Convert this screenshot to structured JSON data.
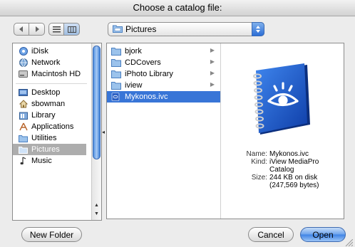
{
  "window": {
    "title": "Choose a catalog file:"
  },
  "toolbar": {
    "back_icon": "back-arrow-icon",
    "forward_icon": "forward-arrow-icon",
    "list_view_icon": "list-view-icon",
    "column_view_icon": "column-view-icon",
    "location": "Pictures"
  },
  "sidebar": {
    "devices": [
      {
        "label": "iDisk",
        "icon": "idisk-icon"
      },
      {
        "label": "Network",
        "icon": "network-globe-icon"
      },
      {
        "label": "Macintosh HD",
        "icon": "hard-drive-icon"
      }
    ],
    "places": [
      {
        "label": "Desktop",
        "icon": "desktop-icon"
      },
      {
        "label": "sbowman",
        "icon": "home-icon"
      },
      {
        "label": "Library",
        "icon": "library-icon"
      },
      {
        "label": "Applications",
        "icon": "applications-icon"
      },
      {
        "label": "Utilities",
        "icon": "utilities-folder-icon"
      },
      {
        "label": "Pictures",
        "icon": "pictures-folder-icon",
        "selected": true
      },
      {
        "label": "Music",
        "icon": "music-icon"
      }
    ]
  },
  "browser": {
    "items": [
      {
        "label": "bjork",
        "icon": "folder-icon",
        "has_children": true
      },
      {
        "label": "CDCovers",
        "icon": "folder-icon",
        "has_children": true
      },
      {
        "label": "iPhoto Library",
        "icon": "folder-icon",
        "has_children": true
      },
      {
        "label": "iview",
        "icon": "folder-icon",
        "has_children": true
      },
      {
        "label": "Mykonos.ivc",
        "icon": "catalog-file-icon",
        "has_children": false,
        "selected": true
      }
    ],
    "preview": {
      "icon": "iview-catalog-book-icon",
      "name_label": "Name:",
      "name_value": "Mykonos.ivc",
      "kind_label": "Kind:",
      "kind_value_1": "iView MediaPro",
      "kind_value_2": "Catalog",
      "size_label": "Size:",
      "size_value_1": "244 KB on disk",
      "size_value_2": "(247,569 bytes)"
    }
  },
  "buttons": {
    "new_folder": "New Folder",
    "cancel": "Cancel",
    "open": "Open"
  },
  "colors": {
    "selection": "#3875d7",
    "sidebar_selection": "#adadad",
    "default_button": "#3d82e4"
  }
}
